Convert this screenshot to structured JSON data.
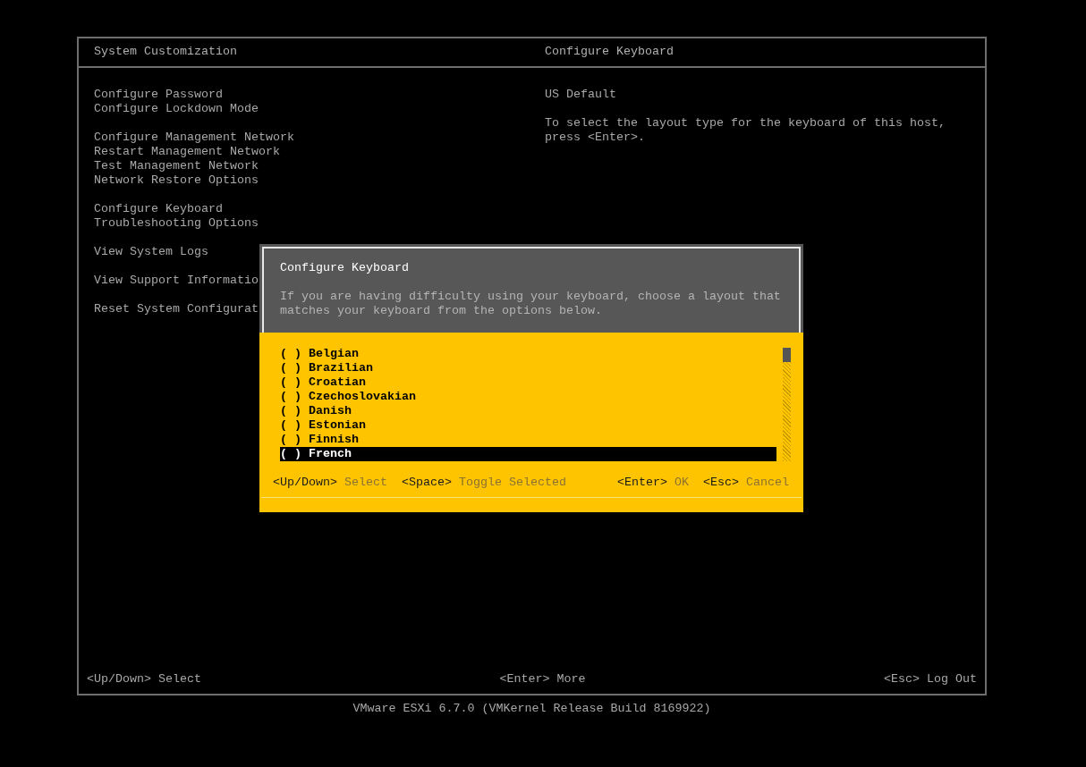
{
  "header": {
    "left_title": "System Customization",
    "right_title": "Configure Keyboard"
  },
  "menu_groups": [
    [
      "Configure Password",
      "Configure Lockdown Mode"
    ],
    [
      "Configure Management Network",
      "Restart Management Network",
      "Test Management Network",
      "Network Restore Options"
    ],
    [
      "Configure Keyboard",
      "Troubleshooting Options"
    ],
    [
      "View System Logs"
    ],
    [
      "View Support Informatio"
    ],
    [
      "Reset System Configurat"
    ]
  ],
  "detail": {
    "value": "US Default",
    "description": "To select the layout type for the keyboard of this host, press <Enter>."
  },
  "dialog": {
    "title": "Configure Keyboard",
    "message": "If you are having difficulty using your keyboard, choose a layout that matches your keyboard from the options below.",
    "options": [
      {
        "marker": "( )",
        "label": "Belgian",
        "selected": false
      },
      {
        "marker": "( )",
        "label": "Brazilian",
        "selected": false
      },
      {
        "marker": "( )",
        "label": "Croatian",
        "selected": false
      },
      {
        "marker": "( )",
        "label": "Czechoslovakian",
        "selected": false
      },
      {
        "marker": "( )",
        "label": "Danish",
        "selected": false
      },
      {
        "marker": "( )",
        "label": "Estonian",
        "selected": false
      },
      {
        "marker": "( )",
        "label": "Finnish",
        "selected": false
      },
      {
        "marker": "( )",
        "label": "French",
        "selected": true
      }
    ],
    "hints_left": [
      {
        "key": "<Up/Down>",
        "action": "Select"
      },
      {
        "key": "<Space>",
        "action": "Toggle Selected"
      }
    ],
    "hints_right": [
      {
        "key": "<Enter>",
        "action": "OK"
      },
      {
        "key": "<Esc>",
        "action": "Cancel"
      }
    ]
  },
  "status_bar": {
    "left": "<Up/Down> Select",
    "center": "<Enter> More",
    "right": "<Esc> Log Out"
  },
  "footer": "VMware ESXi 6.7.0 (VMKernel Release Build 8169922)"
}
